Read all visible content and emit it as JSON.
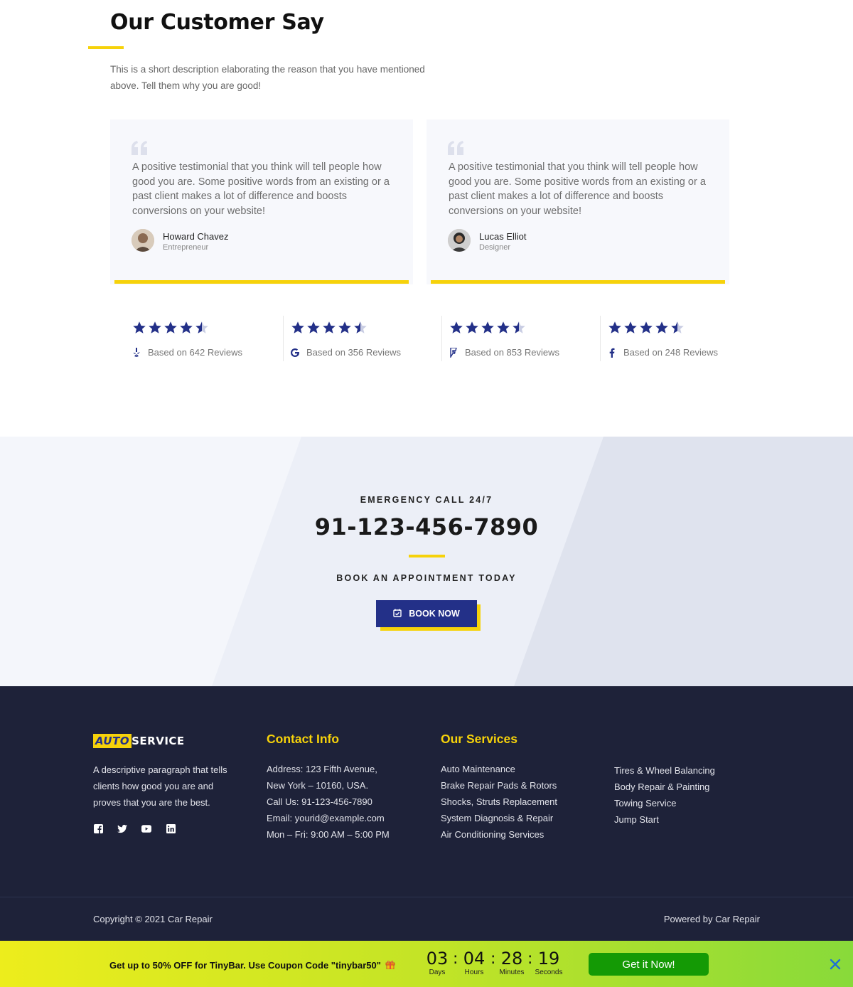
{
  "testimonials": {
    "title": "Our Customer Say",
    "description": "This is a short description elaborating the reason that you have mentioned above. Tell them why you are good!",
    "cards": [
      {
        "text": "A positive testimonial that you think will tell people how good you are. Some positive words from an existing or a past client makes a lot of difference and boosts conversions on your website!",
        "name": "Howard Chavez",
        "role": "Entrepreneur"
      },
      {
        "text": "A positive testimonial that you think will tell people how good you are. Some positive words from an existing or a past client makes a lot of difference and boosts conversions on your website!",
        "name": "Lucas Elliot",
        "role": "Designer"
      }
    ],
    "ratings": [
      {
        "stars": 4.5,
        "label": "Based on 642 Reviews",
        "icon": "yelp-icon"
      },
      {
        "stars": 4.5,
        "label": "Based on 356 Reviews",
        "icon": "google-icon"
      },
      {
        "stars": 4.5,
        "label": "Based on 853 Reviews",
        "icon": "foursquare-icon"
      },
      {
        "stars": 4.5,
        "label": "Based on 248 Reviews",
        "icon": "facebook-icon"
      }
    ]
  },
  "emergency": {
    "label": "EMERGENCY CALL 24/7",
    "phone": "91-123-456-7890",
    "subtitle": "BOOK AN APPOINTMENT TODAY",
    "button": "BOOK NOW"
  },
  "footer": {
    "logo_part1": "AUTO",
    "logo_part2": "SERVICE",
    "description": "A descriptive paragraph that tells clients how good you are and proves that you are the best.",
    "contact_title": "Contact Info",
    "contact": [
      "Address: 123 Fifth Avenue,",
      "New York – 10160, USA.",
      "Call Us: 91-123-456-7890",
      "Email: yourid@example.com",
      "Mon – Fri: 9:00 AM – 5:00 PM"
    ],
    "services_title": "Our Services",
    "services_col1": [
      "Auto Maintenance",
      "Brake Repair Pads & Rotors",
      "Shocks, Struts Replacement",
      "System Diagnosis & Repair",
      "Air Conditioning Services"
    ],
    "services_col2": [
      "Tires & Wheel Balancing",
      "Body Repair & Painting",
      "Towing Service",
      "Jump Start"
    ],
    "copyright": "Copyright © 2021 Car Repair",
    "powered": "Powered by Car Repair"
  },
  "tinybar": {
    "message": "Get up to 50% OFF for TinyBar. Use Coupon Code \"tinybar50\"",
    "countdown": [
      {
        "value": "03",
        "unit": "Days"
      },
      {
        "value": "04",
        "unit": "Hours"
      },
      {
        "value": "28",
        "unit": "Minutes"
      },
      {
        "value": "19",
        "unit": "Seconds"
      }
    ],
    "cta": "Get it Now!"
  },
  "colors": {
    "accent_yellow": "#f6d20a",
    "brand_blue": "#233088",
    "footer_bg": "#1e2239",
    "cta_green": "#149a05"
  }
}
